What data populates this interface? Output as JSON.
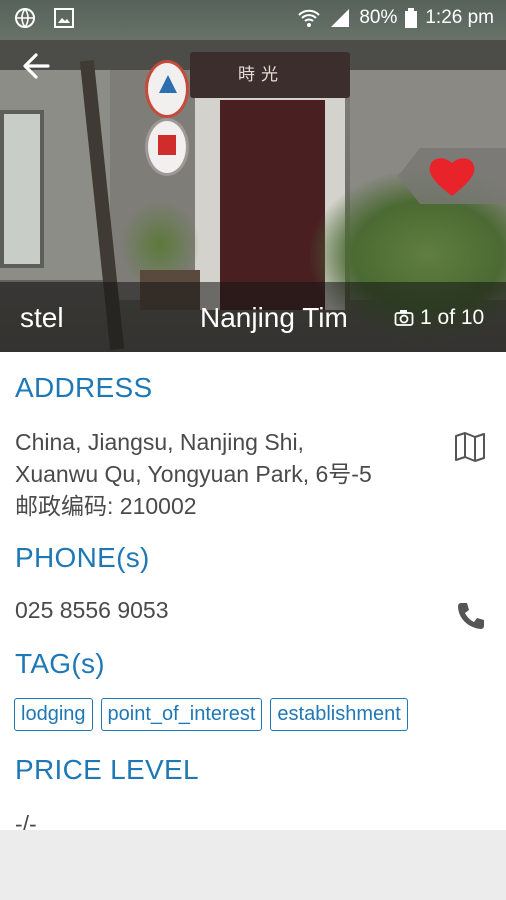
{
  "status_bar": {
    "battery": "80%",
    "time": "1:26 pm"
  },
  "hero": {
    "sign_text": "時光",
    "caption_left": "stel",
    "caption_title": "Nanjing Tim",
    "photo_counter": "1 of 10"
  },
  "address": {
    "title": "ADDRESS",
    "line1": "China, Jiangsu, Nanjing Shi,",
    "line2": "Xuanwu Qu, Yongyuan Park, 6号-5",
    "line3": "邮政编码: 210002"
  },
  "phone": {
    "title": "PHONE(s)",
    "number": "025 8556 9053"
  },
  "tags": {
    "title": "TAG(s)",
    "items": [
      "lodging",
      "point_of_interest",
      "establishment"
    ]
  },
  "price": {
    "title": "PRICE LEVEL",
    "value": "-/-"
  },
  "colors": {
    "accent": "#1f78b6",
    "heart": "#e8242a"
  }
}
